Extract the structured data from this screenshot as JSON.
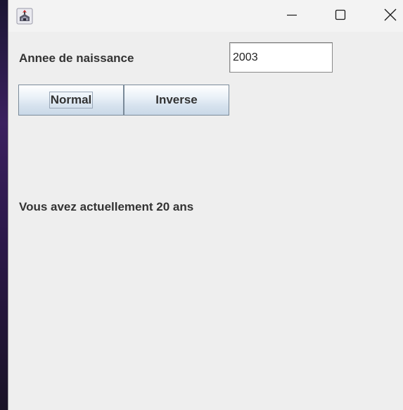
{
  "window": {
    "icon": "java-icon",
    "controls": {
      "minimize_icon": "minimize-icon",
      "maximize_icon": "maximize-icon",
      "close_icon": "close-icon"
    }
  },
  "form": {
    "birth_year_label": "Annee de naissance",
    "birth_year_value": "2003"
  },
  "buttons": {
    "normal_label": "Normal",
    "inverse_label": "Inverse"
  },
  "result": {
    "text": "Vous avez actuellement 20 ans"
  }
}
